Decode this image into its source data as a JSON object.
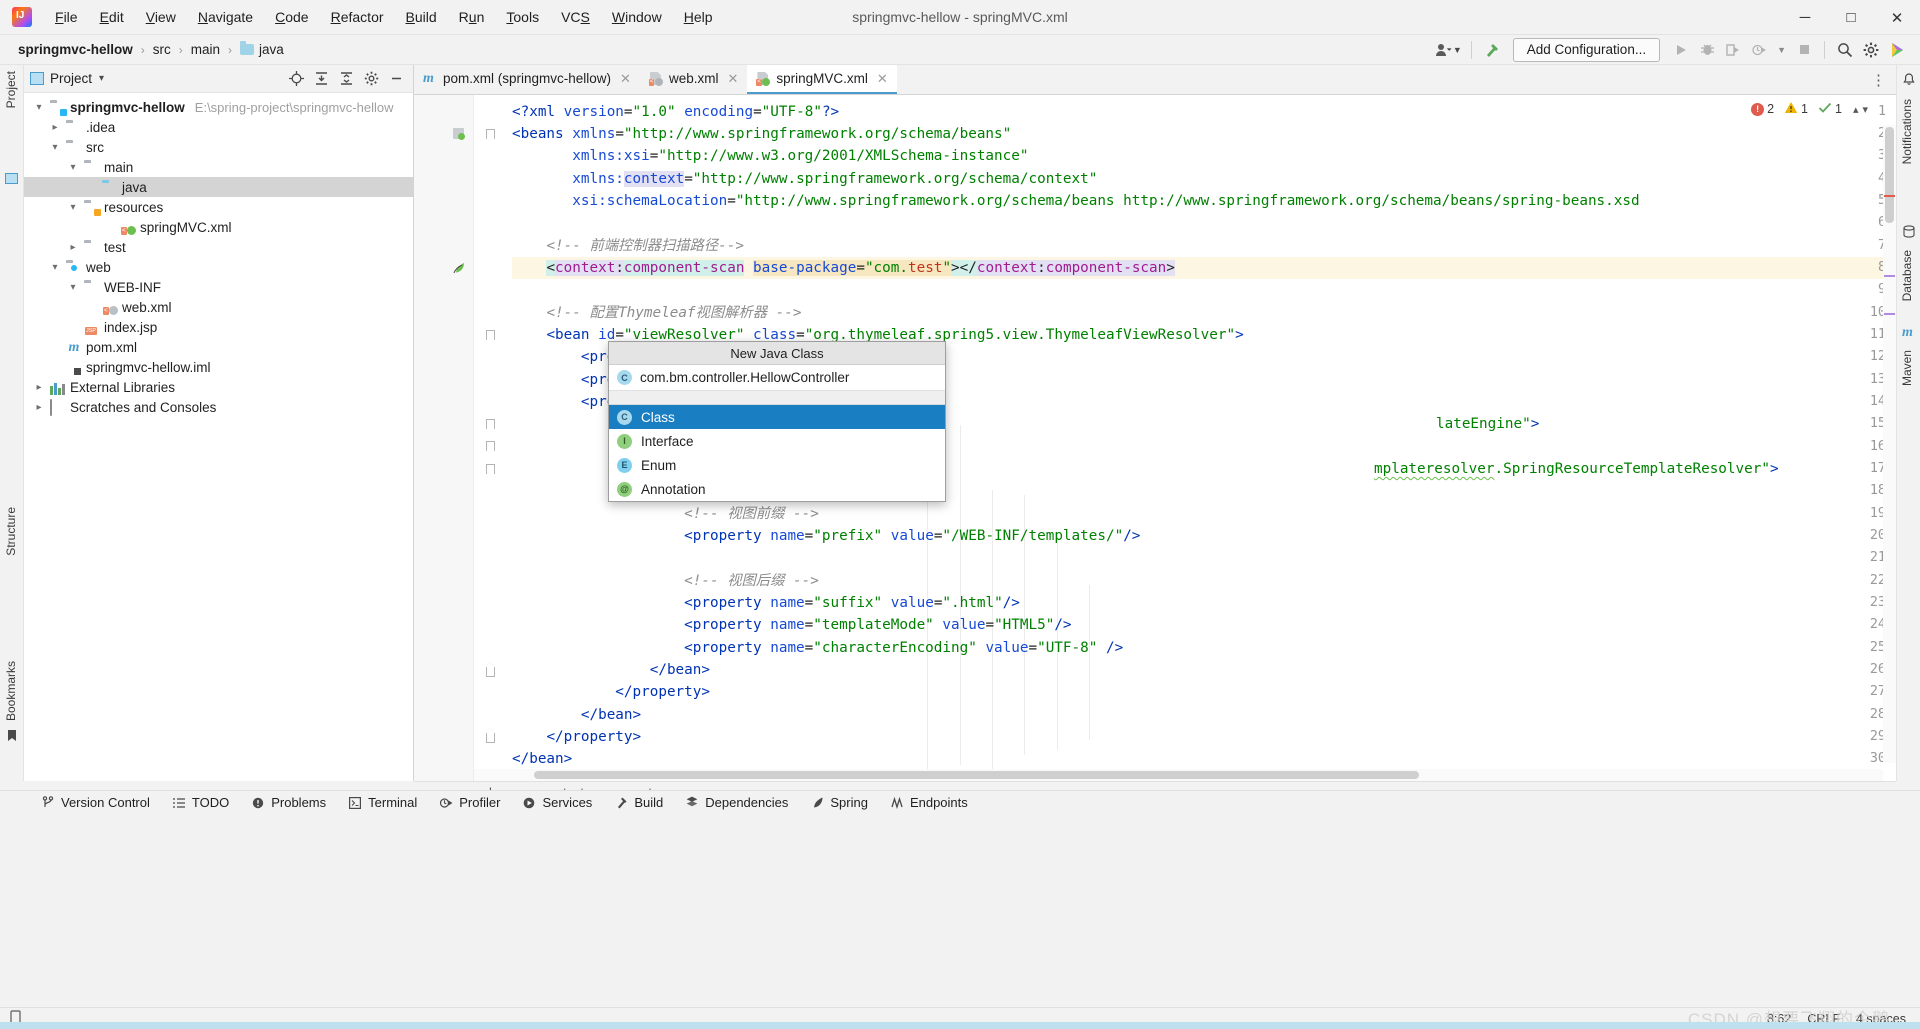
{
  "window": {
    "title": "springmvc-hellow - springMVC.xml",
    "logo_text": "IJ",
    "minimize": "─",
    "maximize": "□",
    "close": "✕"
  },
  "menubar": [
    {
      "label": "File",
      "mnemonic": "F"
    },
    {
      "label": "Edit",
      "mnemonic": "E"
    },
    {
      "label": "View",
      "mnemonic": "V"
    },
    {
      "label": "Navigate",
      "mnemonic": "N"
    },
    {
      "label": "Code",
      "mnemonic": "C"
    },
    {
      "label": "Refactor",
      "mnemonic": "R"
    },
    {
      "label": "Build",
      "mnemonic": "B"
    },
    {
      "label": "Run",
      "mnemonic": "u"
    },
    {
      "label": "Tools",
      "mnemonic": "T"
    },
    {
      "label": "VCS",
      "mnemonic": "S"
    },
    {
      "label": "Window",
      "mnemonic": "W"
    },
    {
      "label": "Help",
      "mnemonic": "H"
    }
  ],
  "navbar": {
    "crumbs": [
      "springmvc-hellow",
      "src",
      "main",
      "java"
    ],
    "separator": "›",
    "add_configuration": "Add Configuration...",
    "icons": {
      "account": "account-icon",
      "hammer": "build-hammer-icon",
      "run": "run-icon",
      "debug": "debug-icon",
      "run_coverage": "run-with-coverage-icon",
      "profile": "profiler-icon",
      "stop": "stop-icon",
      "search": "search-everywhere-icon",
      "settings": "settings-gear-icon",
      "updates": "ide-updates-icon"
    }
  },
  "left_stripe": {
    "project": "Project",
    "structure": "Structure",
    "bookmarks": "Bookmarks"
  },
  "right_stripe": {
    "notifications": "Notifications",
    "database": "Database",
    "maven": "Maven"
  },
  "project_panel": {
    "title": "Project",
    "dropdown": "▾",
    "actions": [
      "locate-icon",
      "expand-all-icon",
      "collapse-all-icon",
      "settings-icon",
      "hide-icon"
    ],
    "tree": [
      {
        "depth": 0,
        "arrow": "v",
        "icon": "folder-module",
        "label": "springmvc-hellow",
        "bold": true,
        "path": "E:\\spring-project\\springmvc-hellow"
      },
      {
        "depth": 1,
        "arrow": ">",
        "icon": "folder",
        "label": ".idea"
      },
      {
        "depth": 1,
        "arrow": "v",
        "icon": "folder",
        "label": "src"
      },
      {
        "depth": 2,
        "arrow": "v",
        "icon": "folder",
        "label": "main"
      },
      {
        "depth": 3,
        "arrow": "",
        "icon": "folder-source",
        "label": "java",
        "selected": true
      },
      {
        "depth": 3,
        "arrow": "v",
        "icon": "folder-resources",
        "label": "resources"
      },
      {
        "depth": 4,
        "arrow": "",
        "icon": "xml-spring",
        "label": "springMVC.xml"
      },
      {
        "depth": 2,
        "arrow": ">",
        "icon": "folder",
        "label": "test"
      },
      {
        "depth": 1,
        "arrow": "v",
        "icon": "folder-web",
        "label": "web"
      },
      {
        "depth": 2,
        "arrow": "v",
        "icon": "folder",
        "label": "WEB-INF"
      },
      {
        "depth": 3,
        "arrow": "",
        "icon": "xml-web",
        "label": "web.xml"
      },
      {
        "depth": 2,
        "arrow": "",
        "icon": "jsp",
        "label": "index.jsp"
      },
      {
        "depth": 1,
        "arrow": "",
        "icon": "maven-pom",
        "label": "pom.xml"
      },
      {
        "depth": 1,
        "arrow": "",
        "icon": "iml",
        "label": "springmvc-hellow.iml"
      },
      {
        "depth": 0,
        "arrow": ">",
        "icon": "libraries",
        "label": "External Libraries"
      },
      {
        "depth": 0,
        "arrow": ">",
        "icon": "scratches",
        "label": "Scratches and Consoles"
      }
    ]
  },
  "editor": {
    "tabs": [
      {
        "label": "pom.xml (springmvc-hellow)",
        "icon": "maven-pom-icon",
        "active": false,
        "close": "✕"
      },
      {
        "label": "web.xml",
        "icon": "xml-web-icon",
        "active": false,
        "close": "✕"
      },
      {
        "label": "springMVC.xml",
        "icon": "xml-spring-icon",
        "active": true,
        "close": "✕"
      }
    ],
    "tab_menu": "⋮",
    "inspections": {
      "errors": "2",
      "warnings": "1",
      "weak": "1",
      "chevron": "⌃"
    },
    "breadcrumb": [
      "beans",
      "context:component-scan"
    ],
    "breadcrumb_sep": "›",
    "lines": [
      {
        "n": 1,
        "text": "<?xml version=\"1.0\" encoding=\"UTF-8\"?>"
      },
      {
        "n": 2,
        "text": "<beans xmlns=\"http://www.springframework.org/schema/beans\""
      },
      {
        "n": 3,
        "text": "       xmlns:xsi=\"http://www.w3.org/2001/XMLSchema-instance\""
      },
      {
        "n": 4,
        "text": "       xmlns:context=\"http://www.springframework.org/schema/context\""
      },
      {
        "n": 5,
        "text": "       xsi:schemaLocation=\"http://www.springframework.org/schema/beans http://www.springframework.org/schema/beans/spring-beans.xsd"
      },
      {
        "n": 6,
        "text": ""
      },
      {
        "n": 7,
        "text": "    <!-- 前端控制器扫描路径-->"
      },
      {
        "n": 8,
        "text": "    <context:component-scan base-package=\"com.test\"></context:component-scan>"
      },
      {
        "n": 9,
        "text": ""
      },
      {
        "n": 10,
        "text": "    <!-- 配置Thymeleaf视图解析器 -->"
      },
      {
        "n": 11,
        "text": "    <bean id=\"viewResolver\" class=\"org.thymeleaf.spring5.view.ThymeleafViewResolver\">"
      },
      {
        "n": 12,
        "text": "        <propert"
      },
      {
        "n": 13,
        "text": "        <propert"
      },
      {
        "n": 14,
        "text": "        <propert"
      },
      {
        "n": 15,
        "text": "            <bea                                    lateEngine\">"
      },
      {
        "n": 16,
        "text": ""
      },
      {
        "n": 17,
        "text": "                                        mplateresolver.SpringResourceTemplateResolver\">"
      },
      {
        "n": 18,
        "text": ""
      },
      {
        "n": 19,
        "text": "                    <!-- 视图前缀 -->"
      },
      {
        "n": 20,
        "text": "                    <property name=\"prefix\" value=\"/WEB-INF/templates/\"/>"
      },
      {
        "n": 21,
        "text": ""
      },
      {
        "n": 22,
        "text": "                    <!-- 视图后缀 -->"
      },
      {
        "n": 23,
        "text": "                    <property name=\"suffix\" value=\".html\"/>"
      },
      {
        "n": 24,
        "text": "                    <property name=\"templateMode\" value=\"HTML5\"/>"
      },
      {
        "n": 25,
        "text": "                    <property name=\"characterEncoding\" value=\"UTF-8\" />"
      },
      {
        "n": 26,
        "text": "                </bean>"
      },
      {
        "n": 27,
        "text": "            </property>"
      },
      {
        "n": 28,
        "text": "        </bean>"
      },
      {
        "n": 29,
        "text": "    </property>"
      },
      {
        "n": 30,
        "text": "</bean>"
      }
    ]
  },
  "popup": {
    "title": "New Java Class",
    "input_value": "com.bm.controller.HellowController",
    "items": [
      {
        "label": "Class",
        "kind": "C",
        "selected": true
      },
      {
        "label": "Interface",
        "kind": "I",
        "selected": false
      },
      {
        "label": "Enum",
        "kind": "E",
        "selected": false
      },
      {
        "label": "Annotation",
        "kind": "@",
        "selected": false
      }
    ]
  },
  "bottom_tools": [
    {
      "label": "Version Control",
      "icon": "branch-icon"
    },
    {
      "label": "TODO",
      "icon": "list-icon"
    },
    {
      "label": "Problems",
      "icon": "problems-icon"
    },
    {
      "label": "Terminal",
      "icon": "terminal-icon"
    },
    {
      "label": "Profiler",
      "icon": "profiler-icon"
    },
    {
      "label": "Services",
      "icon": "services-icon"
    },
    {
      "label": "Build",
      "icon": "hammer-icon"
    },
    {
      "label": "Dependencies",
      "icon": "dependencies-icon"
    },
    {
      "label": "Spring",
      "icon": "spring-leaf-icon"
    },
    {
      "label": "Endpoints",
      "icon": "endpoints-icon"
    }
  ],
  "statusbar": {
    "left_icon": "event-log-icon",
    "caret": "8:62",
    "line_sep": "CRLF",
    "indent": "4 spaces",
    "watermark": "CSDN @想要飞翔的企鹅"
  },
  "colors": {
    "accent": "#4a9ccc",
    "selection": "#1a7ec2",
    "tree_selection": "#d4d4d4",
    "error": "#e05b4b",
    "warning": "#f0b400",
    "ok": "#5ca85c",
    "string": "#008000",
    "tag": "#0033b3",
    "ns": "#9e1d8f",
    "comment": "#8c8c8c",
    "highlight_line": "#fdf6e3"
  }
}
